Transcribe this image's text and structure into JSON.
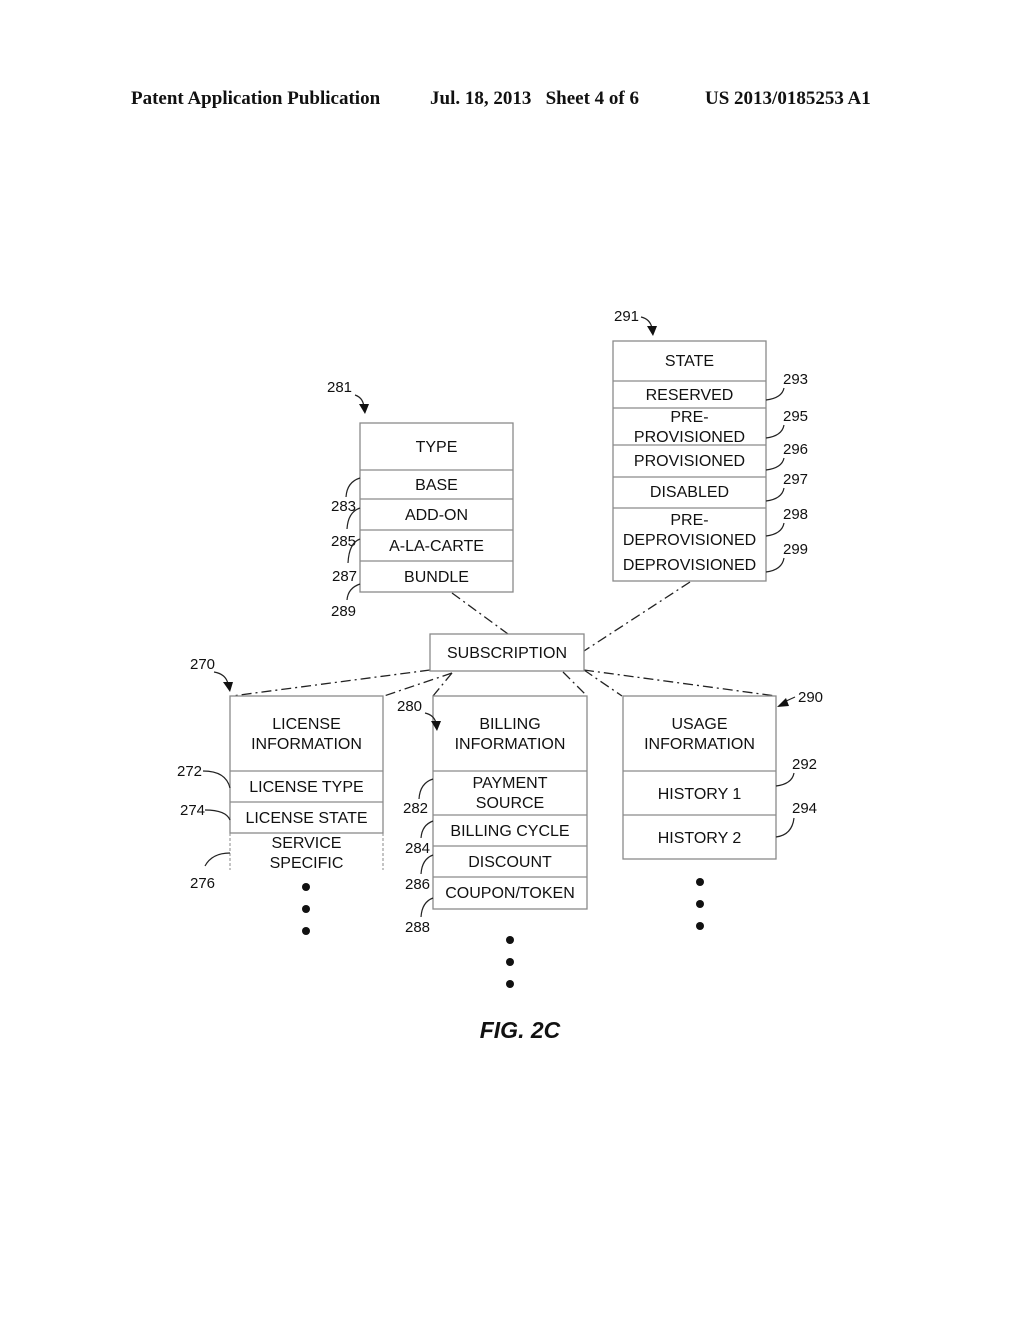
{
  "header": {
    "publication": "Patent Application Publication",
    "date_sheet": "Jul. 18, 2013   Sheet 4 of 6",
    "number": "US 2013/0185253 A1"
  },
  "figure_label": "FIG. 2C",
  "type_table": {
    "ref": "281",
    "title": "TYPE",
    "rows": [
      {
        "label": "BASE",
        "ref": "283"
      },
      {
        "label": "ADD-ON",
        "ref": "285"
      },
      {
        "label": "A-LA-CARTE",
        "ref": "287"
      },
      {
        "label": "BUNDLE",
        "ref": "289"
      }
    ]
  },
  "state_table": {
    "ref": "291",
    "title": "STATE",
    "rows": [
      {
        "label": "RESERVED",
        "ref": "293"
      },
      {
        "label_line1": "PRE-",
        "label_line2": "PROVISIONED",
        "ref": "295"
      },
      {
        "label": "PROVISIONED",
        "ref": "296"
      },
      {
        "label": "DISABLED",
        "ref": "297"
      },
      {
        "label_line1": "PRE-",
        "label_line2": "DEPROVISIONED",
        "ref": "298"
      },
      {
        "label": "DEPROVISIONED",
        "ref": "299"
      }
    ]
  },
  "subscription": {
    "label": "SUBSCRIPTION"
  },
  "license_table": {
    "ref": "270",
    "title_line1": "LICENSE",
    "title_line2": "INFORMATION",
    "rows": [
      {
        "label": "LICENSE TYPE",
        "ref": "272"
      },
      {
        "label": "LICENSE STATE",
        "ref": "274"
      },
      {
        "label_line1": "SERVICE",
        "label_line2": "SPECIFIC",
        "ref": "276"
      }
    ]
  },
  "billing_table": {
    "ref": "280",
    "title_line1": "BILLING",
    "title_line2": "INFORMATION",
    "rows": [
      {
        "label_line1": "PAYMENT",
        "label_line2": "SOURCE",
        "ref": "282"
      },
      {
        "label": "BILLING CYCLE",
        "ref": "284"
      },
      {
        "label": "DISCOUNT",
        "ref": "286"
      },
      {
        "label": "COUPON/TOKEN",
        "ref": "288"
      }
    ]
  },
  "usage_table": {
    "ref": "290",
    "title_line1": "USAGE",
    "title_line2": "INFORMATION",
    "rows": [
      {
        "label": "HISTORY 1",
        "ref": "292"
      },
      {
        "label": "HISTORY 2",
        "ref": "294"
      }
    ]
  }
}
